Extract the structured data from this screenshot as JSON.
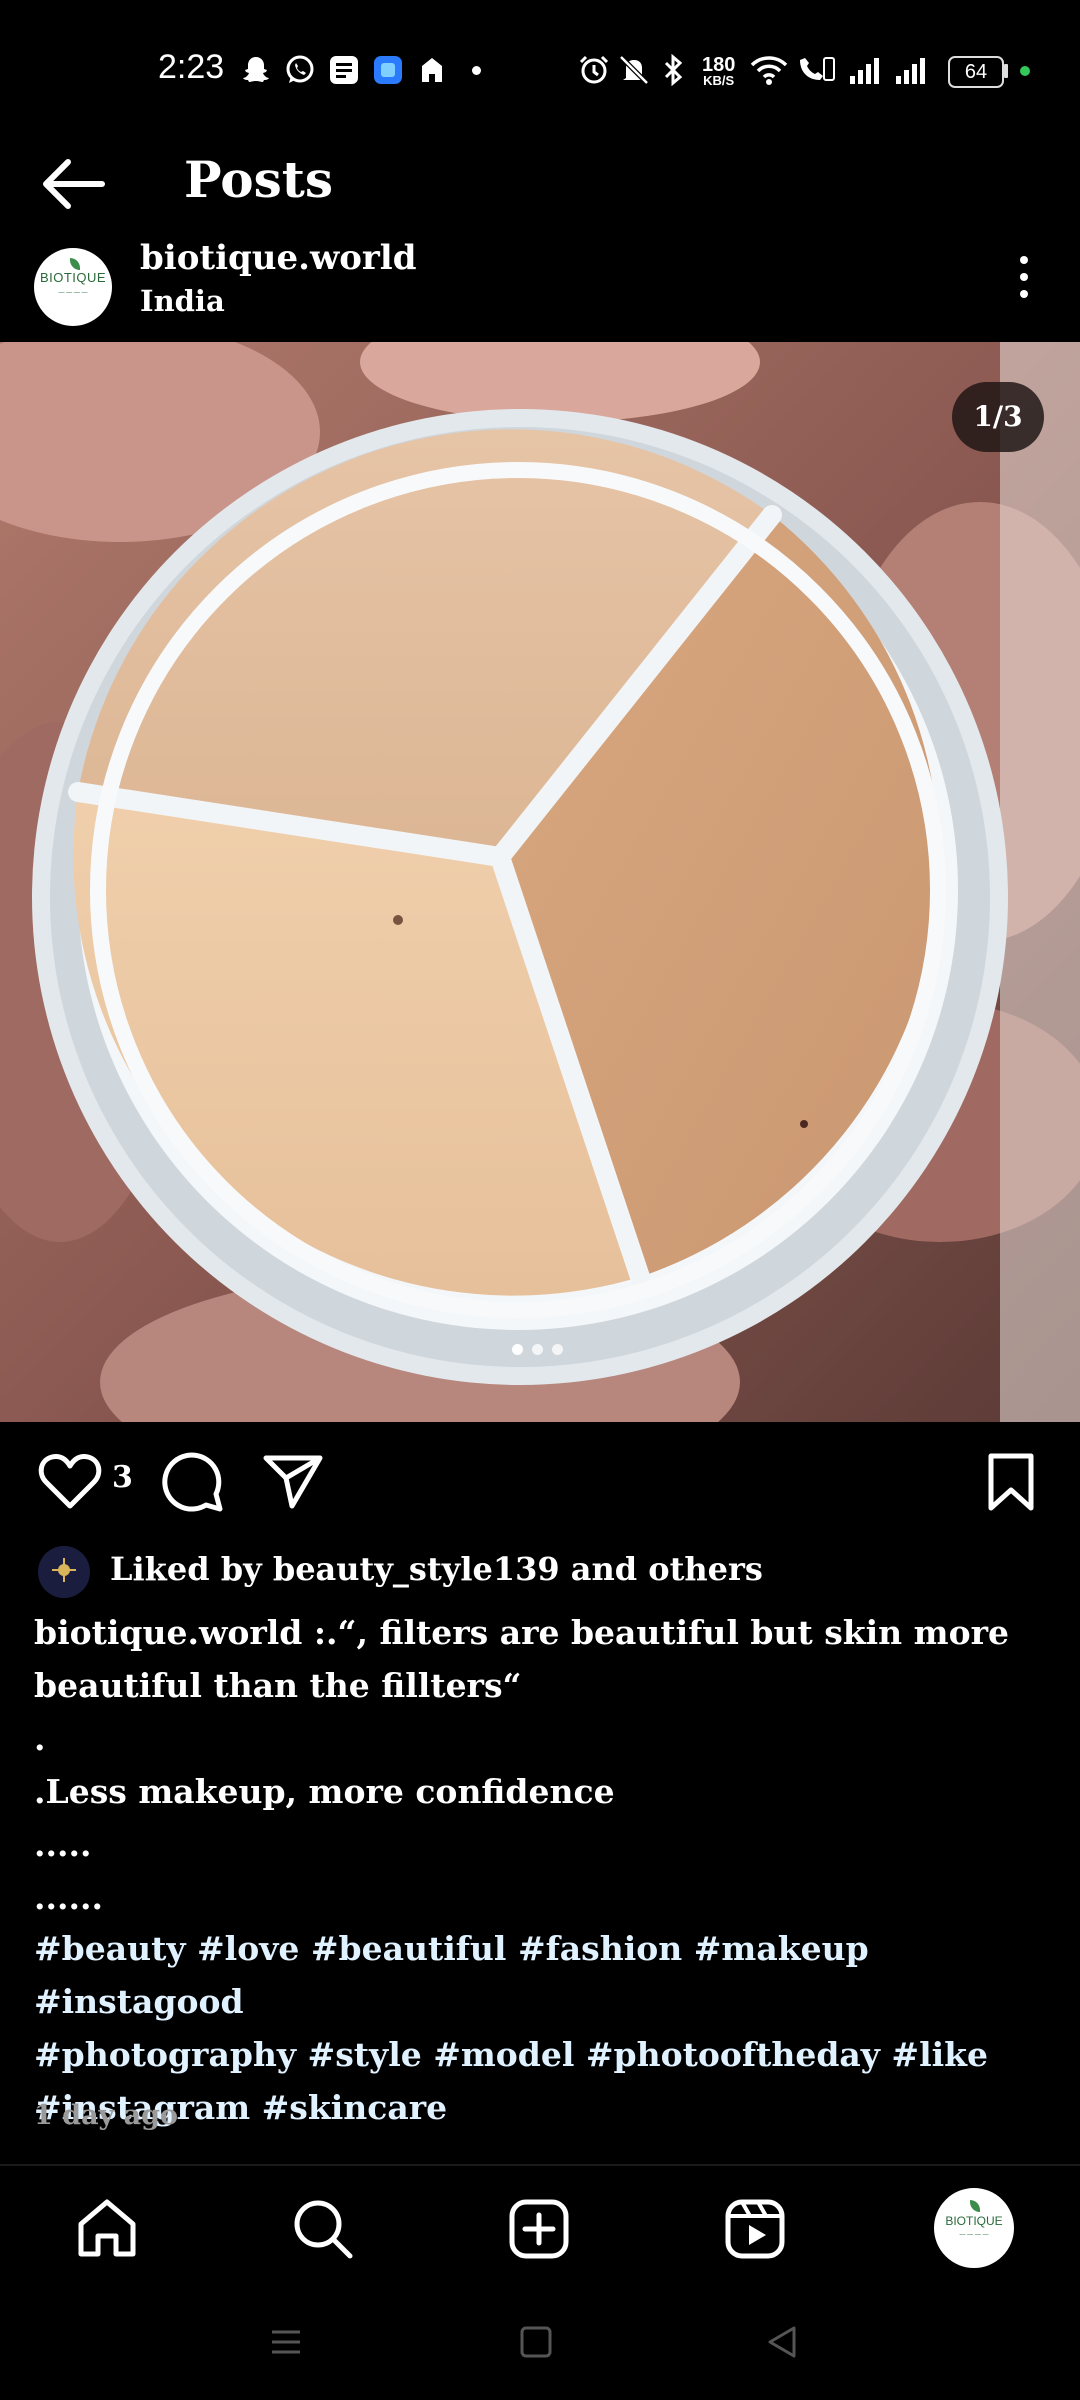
{
  "status_bar": {
    "time": "2:23",
    "network_speed_value": "180",
    "network_speed_unit": "KB/S",
    "battery": "64"
  },
  "header": {
    "title": "Posts"
  },
  "post": {
    "username": "biotique.world",
    "location": "India",
    "avatar_brand": "BIOTIQUE",
    "image_counter": "1/3",
    "like_count": "3",
    "liked_by": "Liked by beauty_style139 and others",
    "caption_lines": [
      "biotique.world :.“, filters are beautiful but skin more",
      "beautiful than the fillters“",
      ".",
      ".Less makeup, more confidence",
      ".....",
      "......"
    ],
    "hashtag_lines": [
      "#beauty #love #beautiful #fashion #makeup #instagood",
      "#photography #style #model #photooftheday #like",
      "#instagram #skincare"
    ],
    "timestamp": "1 day ago"
  },
  "bottom_nav": {
    "profile_brand": "BIOTIQUE"
  },
  "icons": {
    "back": "arrow-left-icon",
    "more": "more-vertical-icon",
    "like": "heart-icon",
    "comment": "comment-icon",
    "share": "send-icon",
    "save": "bookmark-icon",
    "home": "home-icon",
    "search": "search-icon",
    "create": "add-post-icon",
    "reels": "reels-icon"
  }
}
